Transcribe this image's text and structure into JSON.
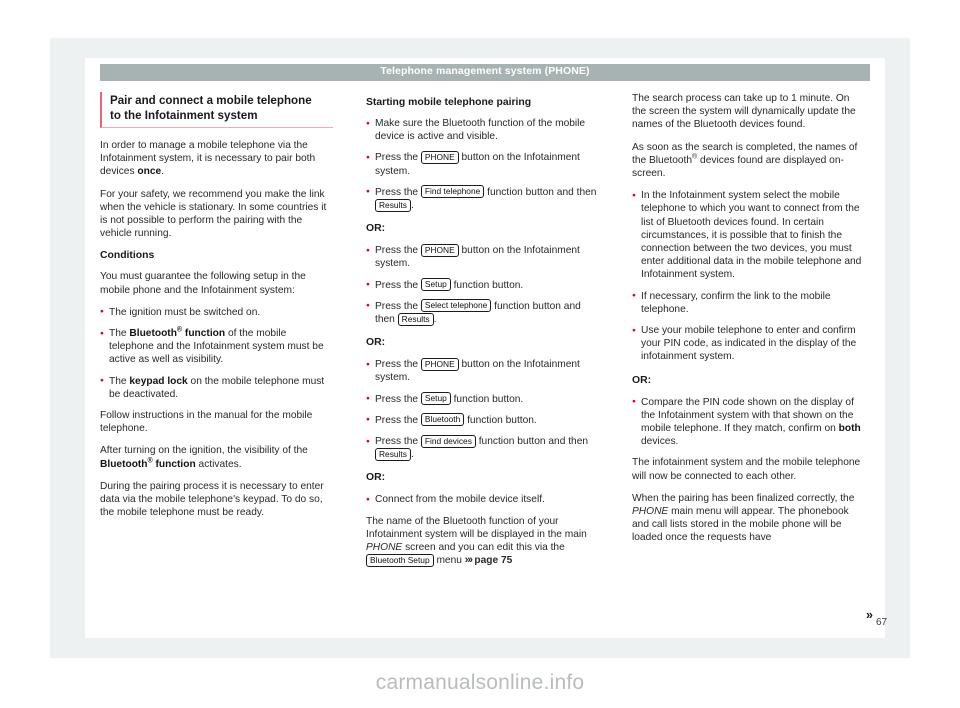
{
  "header": {
    "title": "Telephone management system (PHONE)"
  },
  "folio": "67",
  "watermark": "carmanualsonline.info",
  "colors": {
    "header_bar": "#a7b2b2",
    "heading_rule": "#ef6277",
    "heading_underline": "#f6a8b3",
    "bullet": "#e3001b",
    "page_bg": "#ffffff",
    "outer_frame": "#eef1f2",
    "body_text": "#26292b"
  },
  "col1": {
    "heading_line1": "Pair and connect a mobile telephone",
    "heading_line2": "to the Infotainment system",
    "p1_a": "In order to manage a mobile telephone via the Infotainment system, it is necessary to pair both devices ",
    "p1_b": "once",
    "p1_c": ".",
    "p2": "For your safety, we recommend you make the link when the vehicle is stationary. In some countries it is not possible to perform the pairing with the vehicle running.",
    "conditions_heading": "Conditions",
    "p3": "You must guarantee the following setup in the mobile phone and the Infotainment system:",
    "b1": "The ignition must be switched on.",
    "b2_a": "The ",
    "b2_bold": "Bluetooth",
    "b2_sup": "®",
    "b2_bold2": " function",
    "b2_b": " of the mobile telephone and the Infotainment system must be active as well as visibility.",
    "b3_a": "The ",
    "b3_bold": "keypad lock",
    "b3_b": " on the mobile telephone must be deactivated.",
    "p4": "Follow instructions in the manual for the mobile telephone.",
    "p5_a": "After turning on the ignition, the visibility of the ",
    "p5_bold": "Bluetooth",
    "p5_sup": "®",
    "p5_bold2": " function",
    "p5_b": " activates.",
    "p6": "During the pairing process it is necessary to enter data via the mobile telephone's keypad. To do so, the mobile telephone must be ready."
  },
  "col2": {
    "heading": "Starting mobile telephone pairing",
    "b1": "Make sure the Bluetooth function of the mobile device is active and visible.",
    "b2_a": "Press the ",
    "b2_key": "PHONE",
    "b2_b": " button on the Infotainment system.",
    "b3_a": "Press the ",
    "b3_key": "Find telephone",
    "b3_b": " function button and then ",
    "b3_key2": "Results",
    "b3_c": ".",
    "or1": "OR:",
    "b4_a": "Press the ",
    "b4_key": "PHONE",
    "b4_b": " button on the Infotainment system.",
    "b5_a": "Press the ",
    "b5_key": "Setup",
    "b5_b": " function button.",
    "b6_a": "Press the ",
    "b6_key": "Select telephone",
    "b6_b": " function button and then ",
    "b6_key2": "Results",
    "b6_c": ".",
    "or2": "OR:",
    "b7_a": "Press the ",
    "b7_key": "PHONE",
    "b7_b": " button on the Infotainment system.",
    "b8_a": "Press the ",
    "b8_key": "Setup",
    "b8_b": " function button.",
    "b9_a": "Press the ",
    "b9_key": "Bluetooth",
    "b9_b": " function button.",
    "b10_a": "Press the ",
    "b10_key": "Find devices",
    "b10_b": " function button and then ",
    "b10_key2": "Results",
    "b10_c": ".",
    "or3": "OR:",
    "b11": "Connect from the mobile device itself.",
    "p1_a": "The name of the Bluetooth function of your Infotainment system will be displayed in the main ",
    "p1_italic": "PHONE",
    "p1_b": " screen and you can edit this via the ",
    "p1_key": "Bluetooth Setup",
    "p1_c": " menu ",
    "p1_ref_chev": "»›",
    "p1_ref": "page 75"
  },
  "col3": {
    "p1": "The search process can take up to 1 minute. On the screen the system will dynamically update the names of the Bluetooth devices found.",
    "p2_a": "As soon as the search is completed, the names of the Bluetooth",
    "p2_sup": "®",
    "p2_b": " devices found are displayed on-screen.",
    "b1": "In the Infotainment system select the mobile telephone to which you want to connect from the list of Bluetooth devices found. In certain circumstances, it is possible that to finish the connection between the two devices, you must enter additional data in the mobile telephone and Infotainment system.",
    "b2": "If necessary, confirm the link to the mobile telephone.",
    "b3": "Use your mobile telephone to enter and confirm your PIN code, as indicated in the display of the infotainment system.",
    "or1": "OR:",
    "b4_a": "Compare the PIN code shown on the display of the Infotainment system with that shown on the mobile telephone. If they match, confirm on ",
    "b4_bold": "both",
    "b4_b": " devices.",
    "p3": "The infotainment system and the mobile telephone will now be connected to each other.",
    "p4_a": "When the pairing has been finalized correctly, the ",
    "p4_italic": "PHONE",
    "p4_b": " main menu will appear. The phonebook and call lists stored in the mobile phone will be loaded once the requests have",
    "continue_arrow": "»"
  }
}
